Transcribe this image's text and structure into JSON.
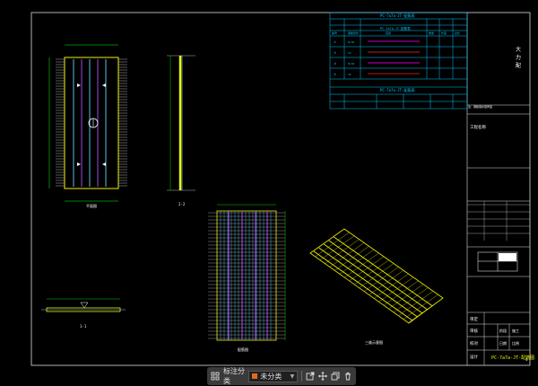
{
  "title_block": {
    "title_chars": [
      "大",
      "力",
      "配"
    ],
    "project_label": "工程名称",
    "drawing_title": "PC-7a7a-JT-配筋图",
    "row_labels": [
      "审定",
      "审核",
      "校对",
      "设计",
      "制图"
    ],
    "stage_label": "阶段",
    "stage_value": "施工",
    "date_label": "日期",
    "scale_label": "比例",
    "page_no": "4"
  },
  "tables": {
    "table1_title": "PC-7a7a-JT-配筋表",
    "table1_header": [
      "编号",
      "钢筋形状",
      "直径",
      "数量",
      "长度",
      "总长",
      "重量"
    ],
    "table1_rows": [
      [
        "①",
        "8/10",
        "",
        "",
        "",
        "",
        ""
      ],
      [
        "②",
        "12",
        "",
        "",
        "",
        "",
        ""
      ],
      [
        "③",
        "8/10",
        "",
        "",
        "",
        "",
        ""
      ],
      [
        "④",
        "12",
        "",
        "",
        "",
        "",
        ""
      ]
    ],
    "table2_title": "PC-7a7a-JT-配筋表",
    "table2_header": [
      "编号",
      "",
      "",
      "",
      "",
      "",
      ""
    ],
    "note": "注：钢筋保护层厚度"
  },
  "views": {
    "plan_label": "平面图",
    "section_label": "1-1",
    "elevation_label": "2-2",
    "rebar_label": "配筋图",
    "iso_label": "三维示意图"
  },
  "toolbar": {
    "mark_label": "标注分类",
    "category_label": "未分类",
    "icons": [
      "layout-icon",
      "export-icon",
      "move-icon",
      "copy-icon",
      "delete-icon"
    ]
  },
  "colors": {
    "frame": "#ffffff",
    "rebar_yellow": "#f2f200",
    "rebar_cyan": "#5fd7ff",
    "rebar_magenta": "#b050ff",
    "table_cyan": "#00c8ff",
    "red": "#ff2020"
  }
}
